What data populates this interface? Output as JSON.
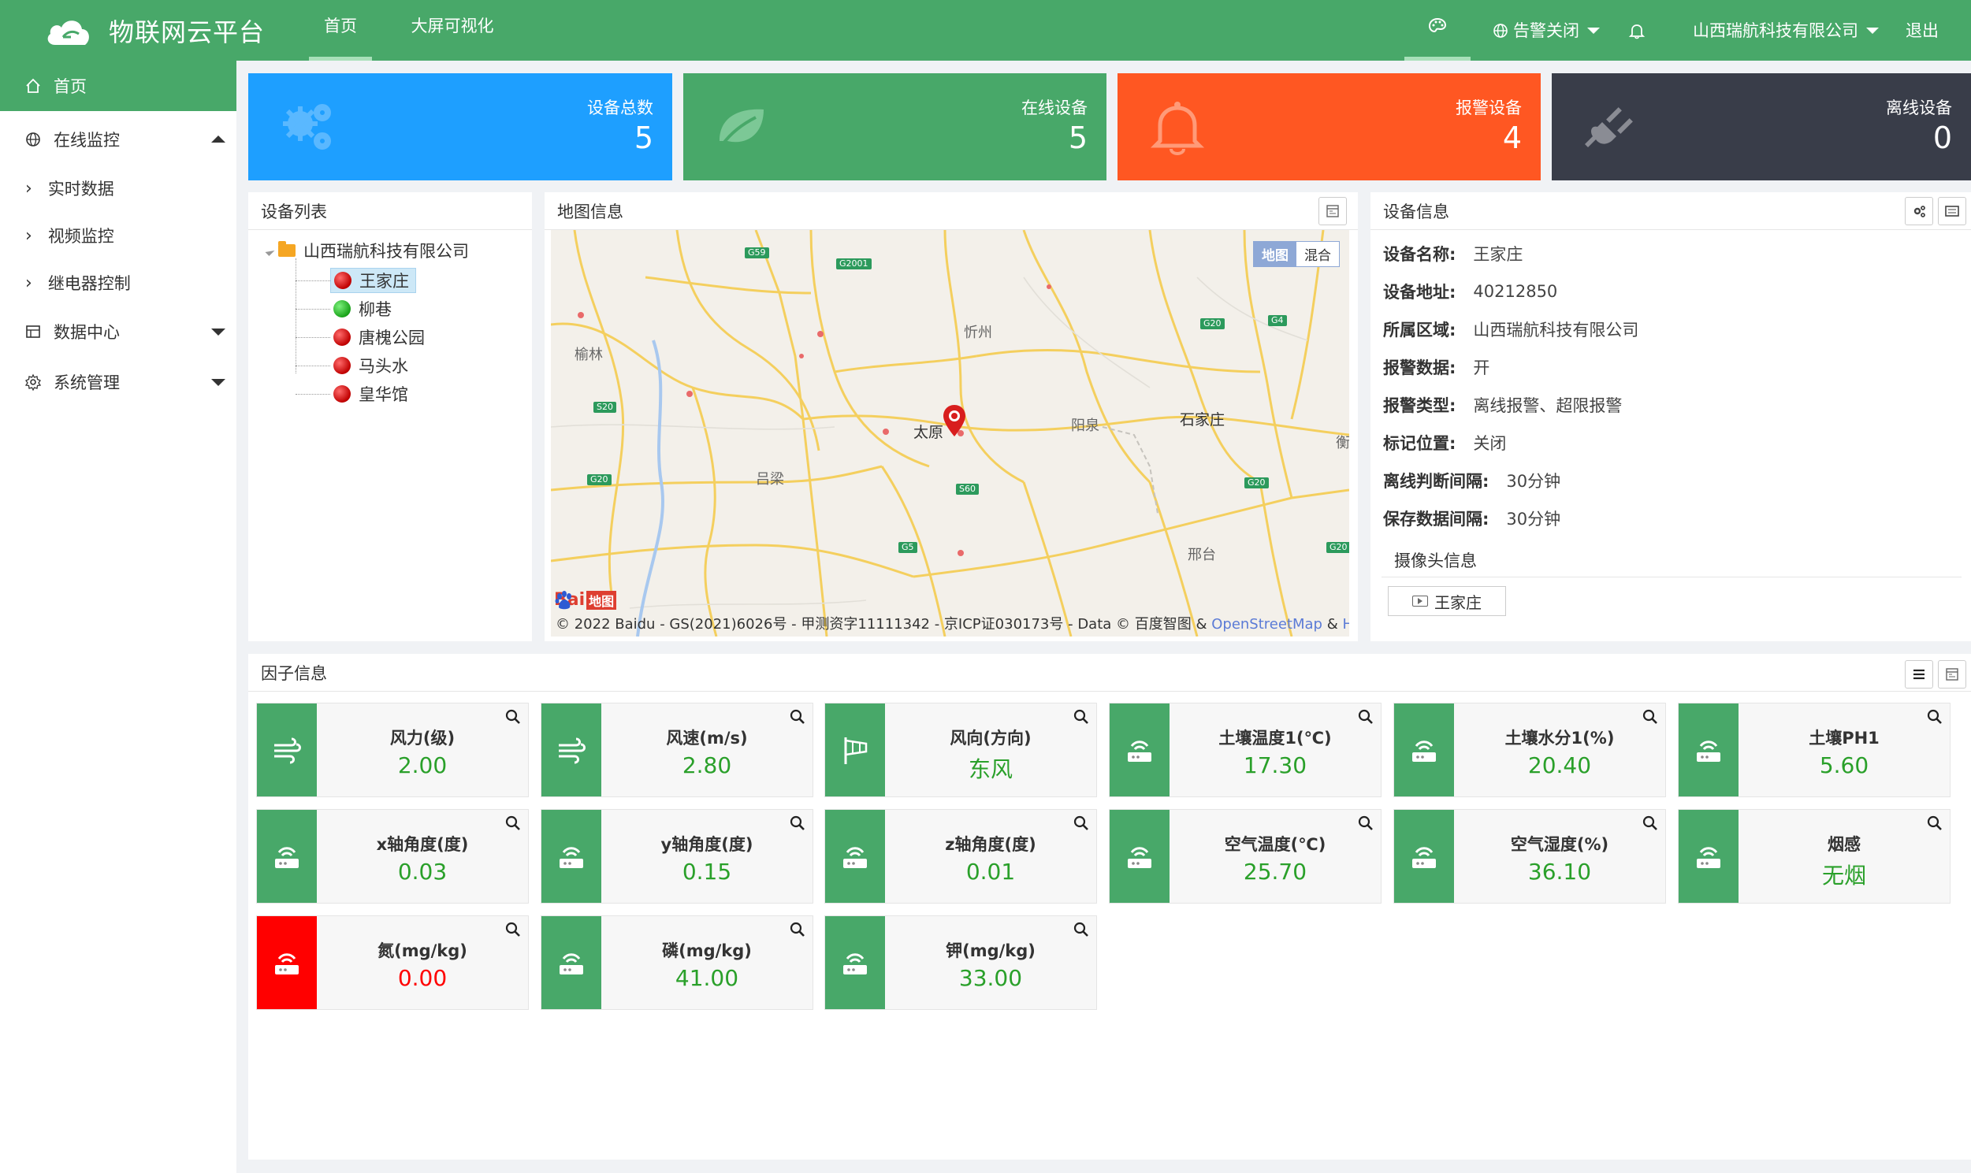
{
  "header": {
    "title": "物联网云平台",
    "nav": [
      {
        "label": "首页",
        "active": true
      },
      {
        "label": "大屏可视化",
        "active": false
      }
    ],
    "alarm_label": "告警关闭",
    "company": "山西瑞航科技有限公司",
    "logout": "退出",
    "icons": [
      "palette-icon",
      "globe-icon",
      "bell-icon"
    ]
  },
  "sidebar": {
    "items": [
      {
        "label": "首页",
        "icon": "home-icon",
        "active": true
      },
      {
        "label": "在线监控",
        "icon": "globe-icon",
        "expanded": true
      },
      {
        "label": "实时数据"
      },
      {
        "label": "视频监控"
      },
      {
        "label": "继电器控制"
      },
      {
        "label": "数据中心",
        "icon": "table-icon"
      },
      {
        "label": "系统管理",
        "icon": "gear-icon"
      }
    ]
  },
  "stats": [
    {
      "label": "设备总数",
      "value": "5",
      "color": "#1e9fff",
      "icon": "gears-icon"
    },
    {
      "label": "在线设备",
      "value": "5",
      "color": "#48a869",
      "icon": "leaf-icon"
    },
    {
      "label": "报警设备",
      "value": "4",
      "color": "#ff5722",
      "icon": "bell-icon"
    },
    {
      "label": "离线设备",
      "value": "0",
      "color": "#393d49",
      "icon": "plug-icon"
    }
  ],
  "device_list": {
    "title": "设备列表",
    "root": "山西瑞航科技有限公司",
    "devices": [
      {
        "name": "王家庄",
        "status": "red",
        "selected": true
      },
      {
        "name": "柳巷",
        "status": "green"
      },
      {
        "name": "唐槐公园",
        "status": "red"
      },
      {
        "name": "马头水",
        "status": "red"
      },
      {
        "name": "皇华馆",
        "status": "red"
      }
    ]
  },
  "map": {
    "title": "地图信息",
    "toggle": [
      "地图",
      "混合"
    ],
    "cities": [
      "榆林",
      "忻州",
      "太原",
      "阳泉",
      "石家庄",
      "吕梁",
      "邢台",
      "衡"
    ],
    "roads": [
      "G59",
      "G2001",
      "G20",
      "G4",
      "S20",
      "G20",
      "S60",
      "G5",
      "G20",
      "G20"
    ],
    "logo": {
      "bai": "Bai",
      "du": "du",
      "map": "地图"
    },
    "copyright_prefix": "© 2022 Baidu - GS(2021)6026号 - 甲测资字11111342 - 京ICP证030173号 - Data © 百度智图 & ",
    "osm": "OpenStreetMap",
    "amp": " & ",
    "here": "HERE"
  },
  "device_info": {
    "title": "设备信息",
    "rows": [
      {
        "k": "设备名称:",
        "v": "王家庄"
      },
      {
        "k": "设备地址:",
        "v": "40212850"
      },
      {
        "k": "所属区域:",
        "v": "山西瑞航科技有限公司"
      },
      {
        "k": "报警数据:",
        "v": "开"
      },
      {
        "k": "报警类型:",
        "v": "离线报警、超限报警"
      },
      {
        "k": "标记位置:",
        "v": "关闭"
      },
      {
        "k": "离线判断间隔:",
        "v": "30分钟"
      },
      {
        "k": "保存数据间隔:",
        "v": "30分钟"
      }
    ],
    "camera_title": "摄像头信息",
    "camera_button": "王家庄"
  },
  "factors": {
    "title": "因子信息",
    "items": [
      {
        "name": "风力(级)",
        "value": "2.00",
        "icon": "wind-icon"
      },
      {
        "name": "风速(m/s)",
        "value": "2.80",
        "icon": "wind-icon"
      },
      {
        "name": "风向(方向)",
        "value": "东风",
        "icon": "windsock-icon"
      },
      {
        "name": "土壤温度1(℃)",
        "value": "17.30",
        "icon": "router-icon"
      },
      {
        "name": "土壤水分1(%)",
        "value": "20.40",
        "icon": "router-icon"
      },
      {
        "name": "土壤PH1",
        "value": "5.60",
        "icon": "router-icon"
      },
      {
        "name": "x轴角度(度)",
        "value": "0.03",
        "icon": "router-icon"
      },
      {
        "name": "y轴角度(度)",
        "value": "0.15",
        "icon": "router-icon"
      },
      {
        "name": "z轴角度(度)",
        "value": "0.01",
        "icon": "router-icon"
      },
      {
        "name": "空气温度(℃)",
        "value": "25.70",
        "icon": "router-icon"
      },
      {
        "name": "空气湿度(%)",
        "value": "36.10",
        "icon": "router-icon"
      },
      {
        "name": "烟感",
        "value": "无烟",
        "icon": "router-icon"
      },
      {
        "name": "氮(mg/kg)",
        "value": "0.00",
        "icon": "router-icon",
        "alarm": true
      },
      {
        "name": "磷(mg/kg)",
        "value": "41.00",
        "icon": "router-icon"
      },
      {
        "name": "钾(mg/kg)",
        "value": "33.00",
        "icon": "router-icon"
      }
    ]
  }
}
